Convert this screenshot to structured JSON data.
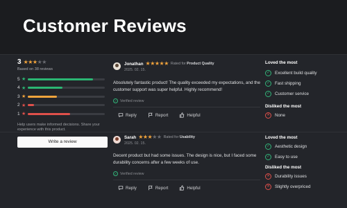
{
  "page": {
    "title": "Customer Reviews"
  },
  "summary": {
    "average": "3",
    "average_stars": 3,
    "based_on": "Based on 38 reviews",
    "distribution": [
      {
        "label": "5",
        "fraction": 0.85,
        "color": "#2bb673"
      },
      {
        "label": "4",
        "fraction": 0.45,
        "color": "#2bb673"
      },
      {
        "label": "3",
        "fraction": 0.38,
        "color": "#f2a43c"
      },
      {
        "label": "2",
        "fraction": 0.08,
        "color": "#e0504b"
      },
      {
        "label": "1",
        "fraction": 0.55,
        "color": "#e0504b"
      }
    ],
    "help_text": "Help users make informed decisions. Share your experience with this product.",
    "write_button": "Write a review"
  },
  "reviews": [
    {
      "name": "Jonathan",
      "stars": 5,
      "rated_for_prefix": "Rated for",
      "rated_for": "Product Quality",
      "date": "2025. 02. 15.",
      "text": "Absolutely fantastic product! The quality exceeded my expectations, and the customer support was super helpful. Highly recommend!",
      "verified": "Verified review",
      "reply": "Reply",
      "report": "Report",
      "helpful": "Helpful",
      "loved_title": "Loved the most",
      "loved": [
        "Excellent build quality",
        "Fast shipping",
        "Customer service"
      ],
      "disliked_title": "Disliked the most",
      "disliked": [
        "None"
      ]
    },
    {
      "name": "Sarah",
      "stars": 3,
      "rated_for_prefix": "Rated for",
      "rated_for": "Usability",
      "date": "2025. 02. 15.",
      "text": "Decent product but had some issues. The design is nice, but I faced some durability concerns after a few weeks of use.",
      "verified": "Verified review",
      "reply": "Reply",
      "report": "Report",
      "helpful": "Helpful",
      "loved_title": "Loved the most",
      "loved": [
        "Aesthetic design",
        "Easy to use"
      ],
      "disliked_title": "Disliked the most",
      "disliked": [
        "Durability issues",
        "Slightly overpriced"
      ]
    }
  ]
}
